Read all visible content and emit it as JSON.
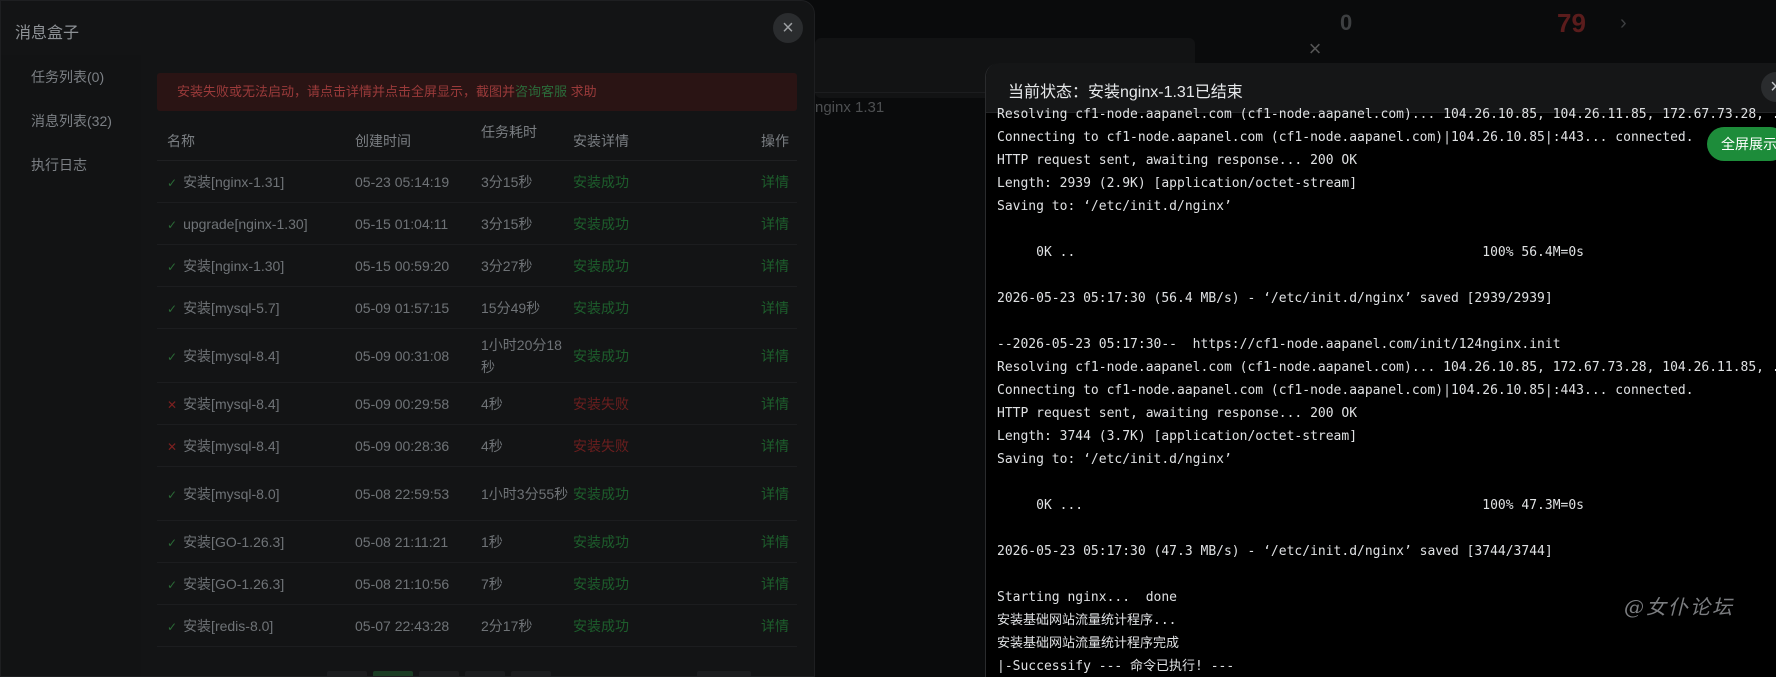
{
  "background": {
    "counter_text": "0",
    "red_value": "79",
    "arrow": "›",
    "row_text": "nginx 1.31"
  },
  "left_modal": {
    "title": "消息盒子",
    "close_symbol": "×",
    "sidebar": [
      {
        "label": "任务列表(0)"
      },
      {
        "label": "消息列表(32)"
      },
      {
        "label": "执行日志"
      }
    ],
    "alert": {
      "text": "安装失败或无法启动，请点击详情并点击全屏显示，截图并",
      "link": "咨询客服",
      "suffix": " 求助"
    },
    "table": {
      "headers": [
        "名称",
        "创建时间",
        "任务耗时",
        "安装详情",
        "操作"
      ],
      "rows": [
        {
          "status": "success",
          "name": "安装[nginx-1.31]",
          "time": "05-23 05:14:19",
          "duration": "3分15秒",
          "detail": "安装成功",
          "op": "详情"
        },
        {
          "status": "success",
          "name": "upgrade[nginx-1.30]",
          "time": "05-15 01:04:11",
          "duration": "3分15秒",
          "detail": "安装成功",
          "op": "详情"
        },
        {
          "status": "success",
          "name": "安装[nginx-1.30]",
          "time": "05-15 00:59:20",
          "duration": "3分27秒",
          "detail": "安装成功",
          "op": "详情"
        },
        {
          "status": "success",
          "name": "安装[mysql-5.7]",
          "time": "05-09 01:57:15",
          "duration": "15分49秒",
          "detail": "安装成功",
          "op": "详情"
        },
        {
          "status": "success",
          "name": "安装[mysql-8.4]",
          "time": "05-09 00:31:08",
          "duration": "1小时20分18秒",
          "detail": "安装成功",
          "op": "详情"
        },
        {
          "status": "fail",
          "name": "安装[mysql-8.4]",
          "time": "05-09 00:29:58",
          "duration": "4秒",
          "detail": "安装失败",
          "op": "详情"
        },
        {
          "status": "fail",
          "name": "安装[mysql-8.4]",
          "time": "05-09 00:28:36",
          "duration": "4秒",
          "detail": "安装失败",
          "op": "详情"
        },
        {
          "status": "success",
          "name": "安装[mysql-8.0]",
          "time": "05-08 22:59:53",
          "duration": "1小时3分55秒",
          "detail": "安装成功",
          "op": "详情"
        },
        {
          "status": "success",
          "name": "安装[GO-1.26.3]",
          "time": "05-08 21:11:21",
          "duration": "1秒",
          "detail": "安装成功",
          "op": "详情"
        },
        {
          "status": "success",
          "name": "安装[GO-1.26.3]",
          "time": "05-08 21:10:56",
          "duration": "7秒",
          "detail": "安装成功",
          "op": "详情"
        },
        {
          "status": "success",
          "name": "安装[redis-8.0]",
          "time": "05-07 22:43:28",
          "duration": "2分17秒",
          "detail": "安装成功",
          "op": "详情"
        }
      ]
    }
  },
  "right_modal": {
    "title": "当前状态：安装nginx-1.31已结束",
    "close_symbol": "×",
    "fullscreen_label": "全屏展示",
    "log_lines": [
      "Resolving cf1-node.aapanel.com (cf1-node.aapanel.com)... 104.26.10.85, 104.26.11.85, 172.67.73.28, ...",
      "Connecting to cf1-node.aapanel.com (cf1-node.aapanel.com)|104.26.10.85|:443... connected.",
      "HTTP request sent, awaiting response... 200 OK",
      "Length: 2939 (2.9K) [application/octet-stream]",
      "Saving to: ‘/etc/init.d/nginx’",
      "",
      "     0K ..                                                    100% 56.4M=0s",
      "",
      "2026-05-23 05:17:30 (56.4 MB/s) - ‘/etc/init.d/nginx’ saved [2939/2939]",
      "",
      "--2026-05-23 05:17:30--  https://cf1-node.aapanel.com/init/124nginx.init",
      "Resolving cf1-node.aapanel.com (cf1-node.aapanel.com)... 104.26.10.85, 172.67.73.28, 104.26.11.85, ...",
      "Connecting to cf1-node.aapanel.com (cf1-node.aapanel.com)|104.26.10.85|:443... connected.",
      "HTTP request sent, awaiting response... 200 OK",
      "Length: 3744 (3.7K) [application/octet-stream]",
      "Saving to: ‘/etc/init.d/nginx’",
      "",
      "     0K ...                                                   100% 47.3M=0s",
      "",
      "2026-05-23 05:17:30 (47.3 MB/s) - ‘/etc/init.d/nginx’ saved [3744/3744]",
      "",
      "Starting nginx...  done",
      "安装基础网站流量统计程序...",
      "安装基础网站流量统计程序完成",
      "|-Successify --- 命令已执行! ---"
    ]
  },
  "watermark": "@女仆论坛",
  "colors": {
    "success": "#1d5e2c",
    "fail": "#6b1e1e",
    "accent_button": "#1d8c3a"
  }
}
